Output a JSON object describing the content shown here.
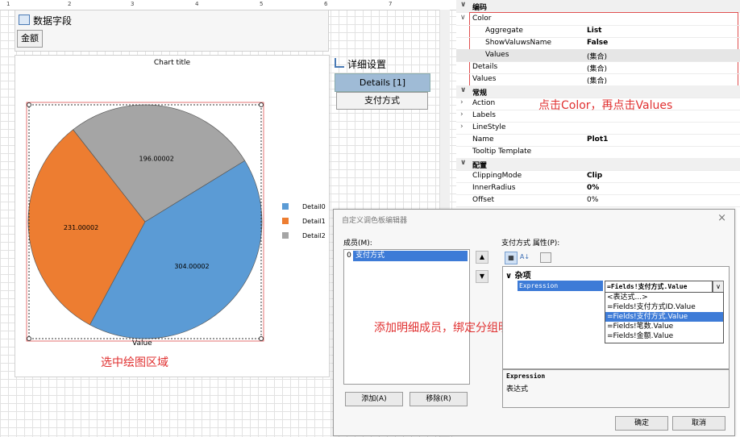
{
  "ruler": {
    "marks": [
      "1",
      "2",
      "3",
      "4",
      "5",
      "6",
      "7"
    ]
  },
  "data_panel": {
    "title": "数据字段",
    "field_button": "金额"
  },
  "chart": {
    "title": "Chart title",
    "xlabel": "Value",
    "annotation": "选中绘图区域"
  },
  "chart_data": {
    "type": "pie",
    "title": "Chart title",
    "xlabel": "Value",
    "categories": [
      "Detail0",
      "Detail1",
      "Detail2"
    ],
    "values": [
      304.00002,
      231.00002,
      196.00002
    ],
    "labels": [
      "304.00002",
      "231.00002",
      "196.00002"
    ],
    "colors": [
      "#5b9bd5",
      "#ed7d31",
      "#a5a5a5"
    ],
    "legend_position": "right"
  },
  "detail_panel": {
    "title": "详细设置",
    "selected": "Details [1]",
    "button": "支付方式"
  },
  "properties": {
    "sections": {
      "encoding": "编码",
      "general": "常规",
      "config": "配置"
    },
    "rows": {
      "color": "Color",
      "aggregate_k": "Aggregate",
      "aggregate_v": "List",
      "showname_k": "ShowValuwsName",
      "showname_v": "False",
      "values_k": "Values",
      "values_v": "(集合)",
      "details_k": "Details",
      "details_v": "(集合)",
      "values2_k": "Values",
      "values2_v": "(集合)",
      "action": "Action",
      "labels": "Labels",
      "linestyle": "LineStyle",
      "name_k": "Name",
      "name_v": "Plot1",
      "tooltip": "Tooltip Template",
      "clip_k": "ClippingMode",
      "clip_v": "Clip",
      "inner_k": "InnerRadius",
      "inner_v": "0%",
      "offset_k": "Offset",
      "offset_v": "0%"
    },
    "annotation": "点击Color，再点击Values"
  },
  "dialog": {
    "title": "自定义调色板编辑器",
    "members_label": "成员(M):",
    "member_index": "0",
    "member_item": "支付方式",
    "props_label": "支付方式 属性(P):",
    "category": "杂项",
    "expr_key": "Expression",
    "expr_value": "=Fields!支付方式.Value",
    "options": [
      "<表达式...>",
      "=Fields!支付方式ID.Value",
      "=Fields!支付方式.Value",
      "=Fields!笔数.Value",
      "=Fields!金额.Value"
    ],
    "desc_title": "Expression",
    "desc_text": "表达式",
    "add_button": "添加(A)",
    "remove_button": "移除(R)",
    "ok_button": "确定",
    "cancel_button": "取消",
    "annotation": "添加明细成员，绑定分组明细"
  }
}
